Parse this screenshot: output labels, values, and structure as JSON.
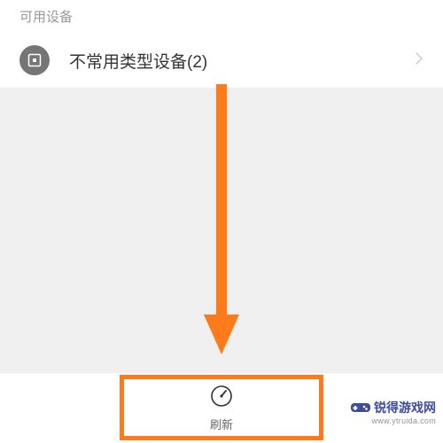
{
  "section": {
    "header": "可用设备"
  },
  "devices": {
    "uncommon": {
      "label": "不常用类型设备(2)"
    }
  },
  "bottom": {
    "refresh_label": "刷新"
  },
  "watermark": {
    "text": "锐得游戏网",
    "url": "www.ytruida.com"
  }
}
